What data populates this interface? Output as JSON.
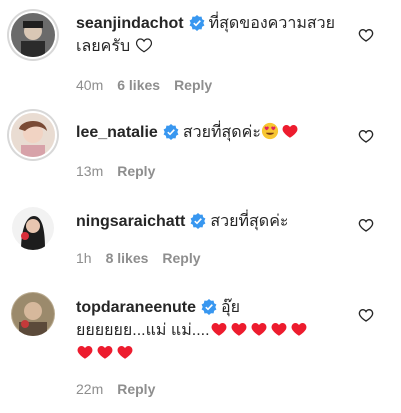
{
  "comments": [
    {
      "username": "seanjindachot",
      "verified": true,
      "text": "ที่สุดของความสวยเลยครับ",
      "trailing_emoji": "white-heart-icon",
      "time": "40m",
      "likes": "6 likes",
      "reply": "Reply",
      "avatar_ring": true
    },
    {
      "username": "lee_natalie",
      "verified": true,
      "text": "สวยที่สุดค่ะ",
      "trailing_emoji": "heart-eyes-emoji + red-heart-emoji",
      "time": "13m",
      "likes": "",
      "reply": "Reply",
      "avatar_ring": true
    },
    {
      "username": "ningsaraichatt",
      "verified": true,
      "text": "สวยที่สุดค่ะ",
      "time": "1h",
      "likes": "8 likes",
      "reply": "Reply",
      "avatar_ring": false
    },
    {
      "username": "topdaraneenute",
      "verified": true,
      "text_line1": "อุ๊ย",
      "text_line2": "ยยยยยย...แม่ แม่....",
      "hearts_count": 8,
      "time": "22m",
      "likes": "",
      "reply": "Reply",
      "avatar_ring": false
    }
  ],
  "colors": {
    "verified_blue": "#3897f0",
    "meta_gray": "#8e8e8e",
    "text": "#262626",
    "heart_red": "#ed1c2e"
  }
}
